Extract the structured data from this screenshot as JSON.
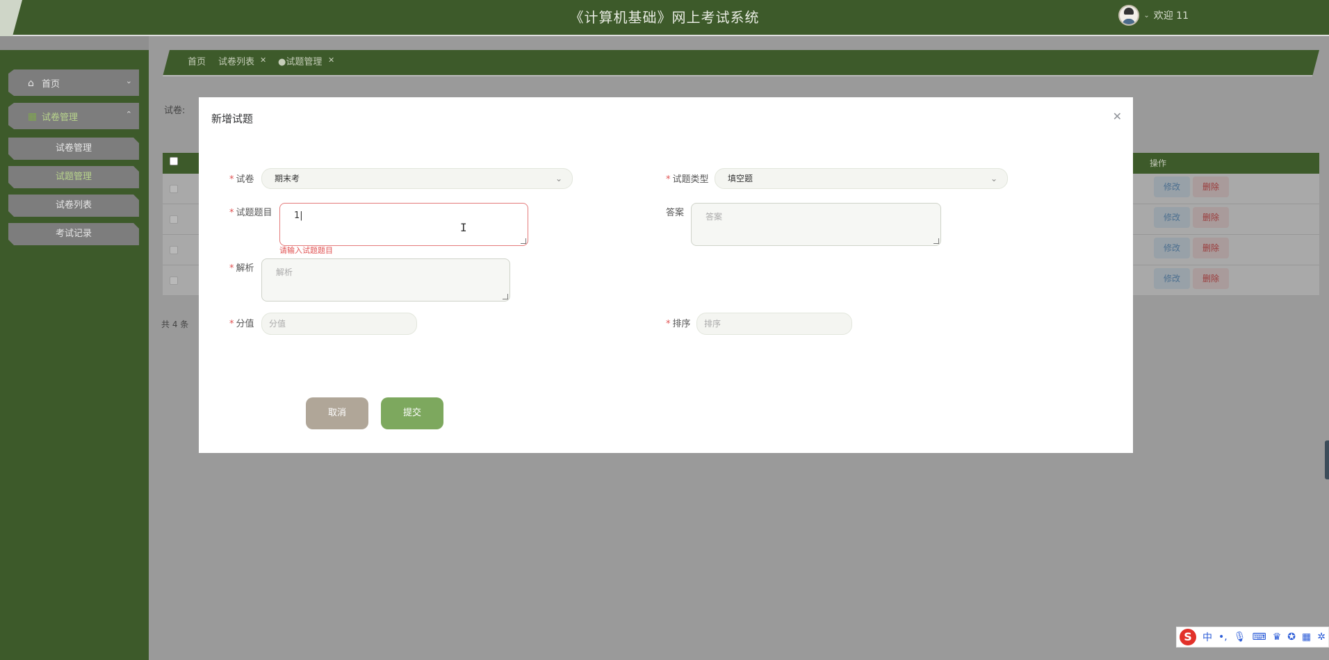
{
  "header": {
    "title": "《计算机基础》网上考试系统",
    "welcome": "欢迎 11"
  },
  "sidebar": {
    "items": [
      {
        "label": "首页"
      },
      {
        "label": "试卷管理"
      }
    ],
    "sub_items": [
      {
        "label": "试卷管理"
      },
      {
        "label": "试题管理"
      },
      {
        "label": "试卷列表"
      },
      {
        "label": "考试记录"
      }
    ]
  },
  "tabs": [
    {
      "label": "首页"
    },
    {
      "label": "试卷列表"
    },
    {
      "label": "●试题管理"
    }
  ],
  "content": {
    "filter_label": "试卷:",
    "table": {
      "action_header": "操作",
      "edit_label": "修改",
      "delete_label": "删除"
    },
    "total": "共 4 条"
  },
  "modal": {
    "title": "新增试题",
    "fields": {
      "paper": {
        "label": "试卷",
        "value": "期末考"
      },
      "question_type": {
        "label": "试题类型",
        "value": "填空题"
      },
      "question": {
        "label": "试题题目",
        "value": "1|",
        "error": "请输入试题题目"
      },
      "answer": {
        "label": "答案",
        "placeholder": "答案"
      },
      "analysis": {
        "label": "解析",
        "placeholder": "解析"
      },
      "score": {
        "label": "分值",
        "placeholder": "分值"
      },
      "sort": {
        "label": "排序",
        "placeholder": "排序"
      }
    },
    "cancel_label": "取消",
    "submit_label": "提交"
  },
  "ime": {
    "lang": "中",
    "punct": "•,"
  }
}
